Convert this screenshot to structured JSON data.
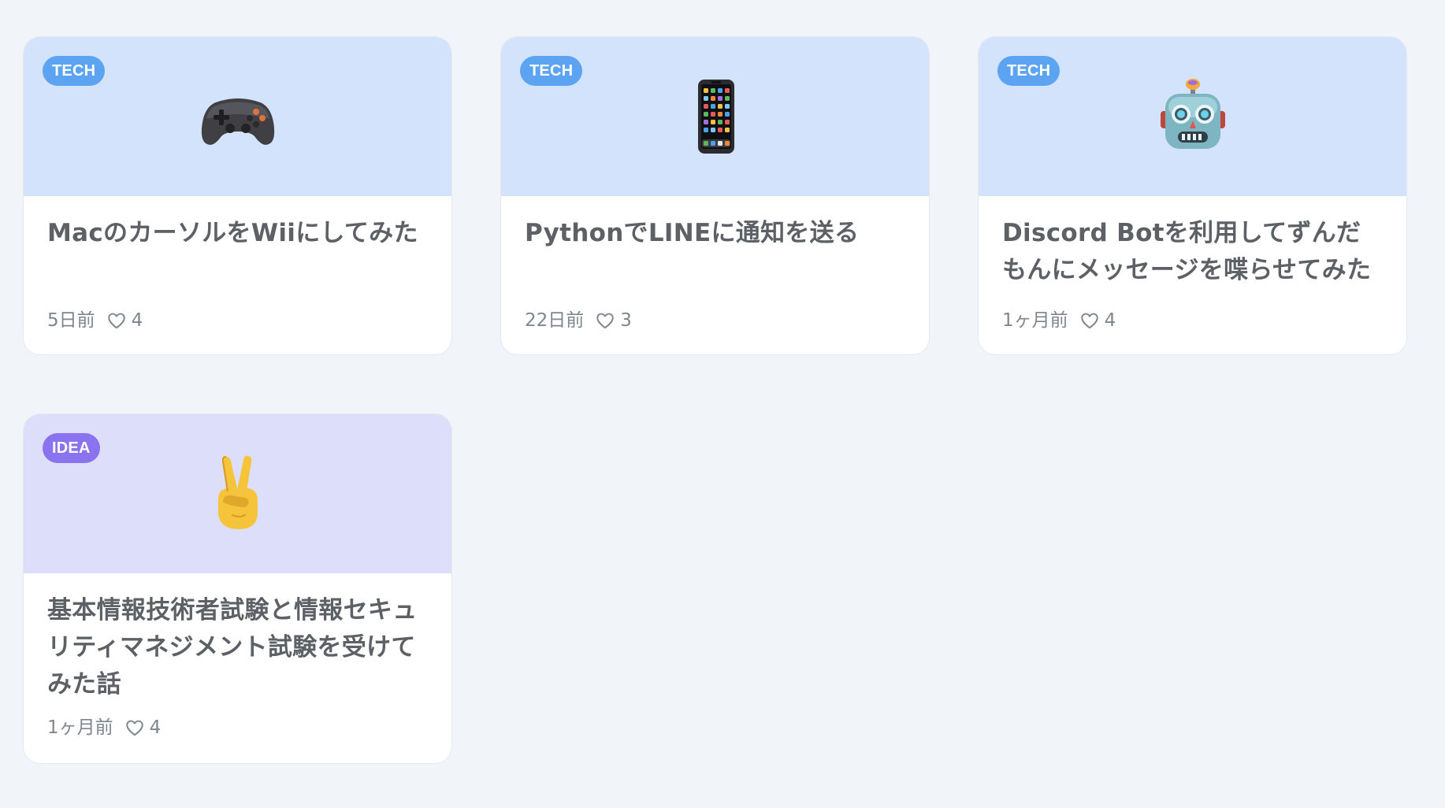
{
  "colors": {
    "background": "#f1f5fa",
    "tech_thumb": "#d4e3fc",
    "idea_thumb": "#dcdefa",
    "tech_badge": "#5ca4f2",
    "idea_badge": "#8b72ef",
    "title_text": "#5d6166",
    "meta_text": "#7e868f"
  },
  "cards": [
    {
      "category": "TECH",
      "icon": "game-controller-icon",
      "title": "MacのカーソルをWiiにしてみた",
      "date": "5日前",
      "likes": "4"
    },
    {
      "category": "TECH",
      "icon": "mobile-phone-icon",
      "title": "PythonでLINEに通知を送る",
      "date": "22日前",
      "likes": "3"
    },
    {
      "category": "TECH",
      "icon": "robot-icon",
      "title": "Discord Botを利用してずんだもんにメッセージを喋らせてみた",
      "date": "1ヶ月前",
      "likes": "4"
    },
    {
      "category": "IDEA",
      "icon": "victory-hand-icon",
      "title": "基本情報技術者試験と情報セキュリティマネジメント試験を受けてみた話",
      "date": "1ヶ月前",
      "likes": "4"
    }
  ]
}
